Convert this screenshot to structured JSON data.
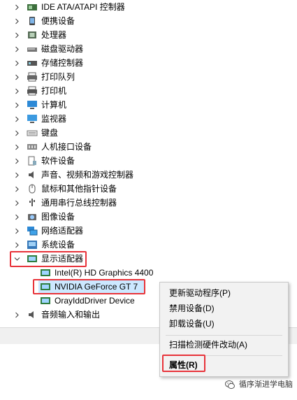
{
  "tree": {
    "categories": [
      {
        "label": "IDE ATA/ATAPI 控制器",
        "icon": "ide-controller-icon"
      },
      {
        "label": "便携设备",
        "icon": "portable-device-icon"
      },
      {
        "label": "处理器",
        "icon": "processor-icon"
      },
      {
        "label": "磁盘驱动器",
        "icon": "disk-drive-icon"
      },
      {
        "label": "存储控制器",
        "icon": "storage-controller-icon"
      },
      {
        "label": "打印队列",
        "icon": "print-queue-icon"
      },
      {
        "label": "打印机",
        "icon": "printer-icon"
      },
      {
        "label": "计算机",
        "icon": "computer-icon"
      },
      {
        "label": "监视器",
        "icon": "monitor-icon"
      },
      {
        "label": "键盘",
        "icon": "keyboard-icon"
      },
      {
        "label": "人机接口设备",
        "icon": "hid-icon"
      },
      {
        "label": "软件设备",
        "icon": "software-device-icon"
      },
      {
        "label": "声音、视频和游戏控制器",
        "icon": "sound-icon"
      },
      {
        "label": "鼠标和其他指针设备",
        "icon": "mouse-icon"
      },
      {
        "label": "通用串行总线控制器",
        "icon": "usb-icon"
      },
      {
        "label": "图像设备",
        "icon": "imaging-device-icon"
      },
      {
        "label": "网络适配器",
        "icon": "network-adapter-icon"
      },
      {
        "label": "系统设备",
        "icon": "system-device-icon"
      }
    ],
    "display_adapters": {
      "label": "显示适配器",
      "children": [
        "Intel(R) HD Graphics 4400",
        "NVIDIA GeForce GT 7",
        "OrayIddDriver Device"
      ]
    },
    "audio_io": {
      "label": "音频输入和输出"
    }
  },
  "context_menu": {
    "items": [
      {
        "label": "更新驱动程序(P)"
      },
      {
        "label": "禁用设备(D)"
      },
      {
        "label": "卸载设备(U)"
      },
      {
        "label": "扫描检测硬件改动(A)"
      },
      {
        "label": "属性(R)"
      }
    ]
  },
  "watermark": {
    "text": "循序渐进学电脑"
  },
  "colors": {
    "highlight": "#e8333a",
    "selection": "#cce8ff"
  }
}
